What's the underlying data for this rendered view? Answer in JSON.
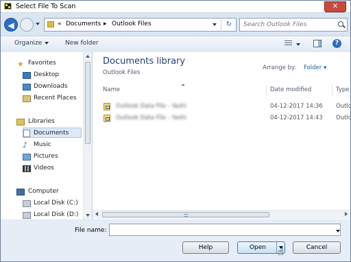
{
  "window": {
    "title": "Select File To Scan",
    "close_glyph": "✕"
  },
  "nav": {
    "back_glyph": "◀"
  },
  "address": {
    "root_glyph": "«",
    "crumbs": [
      "Documents",
      "Outlook Files"
    ],
    "sep": "▸",
    "refresh_glyph": "↻"
  },
  "search": {
    "placeholder": "Search Outlook Files"
  },
  "toolbar": {
    "organize": "Organize",
    "new_folder": "New folder",
    "help": "?"
  },
  "sidebar": {
    "groups": [
      {
        "label": "Favorites",
        "icon": "star-icon",
        "items": [
          {
            "label": "Desktop",
            "icon": "desktop-icon"
          },
          {
            "label": "Downloads",
            "icon": "downloads-icon"
          },
          {
            "label": "Recent Places",
            "icon": "recent-places-icon"
          }
        ]
      },
      {
        "label": "Libraries",
        "icon": "libraries-icon",
        "items": [
          {
            "label": "Documents",
            "icon": "documents-icon",
            "selected": true
          },
          {
            "label": "Music",
            "icon": "music-icon"
          },
          {
            "label": "Pictures",
            "icon": "pictures-icon"
          },
          {
            "label": "Videos",
            "icon": "videos-icon"
          }
        ]
      },
      {
        "label": "Computer",
        "icon": "computer-icon",
        "items": [
          {
            "label": "Local Disk (C:)",
            "icon": "disk-icon"
          },
          {
            "label": "Local Disk (D:)",
            "icon": "disk-icon"
          }
        ]
      }
    ]
  },
  "main": {
    "library_title": "Documents library",
    "library_subtitle": "Outlook Files",
    "arrange_label": "Arrange by:",
    "arrange_value": "Folder ▾",
    "columns": [
      "Name",
      "Date modified",
      "Type"
    ],
    "files": [
      {
        "name": "Outlook Data File - Yashi",
        "date": "04-12-2017 14:36",
        "type": "Outlo"
      },
      {
        "name": "Outlook Data File - Yashi",
        "date": "04-12-2017 14:43",
        "type": "Outlo"
      }
    ]
  },
  "footer": {
    "file_name_label": "File name:",
    "file_name_value": "",
    "help_button": "Help",
    "open_button": "Open",
    "cancel_button": "Cancel"
  },
  "colors": {
    "accent": "#2b6ec5",
    "title_text": "#1e3f75",
    "selection": "#dce9f8"
  },
  "cursor_glyph": "☝"
}
